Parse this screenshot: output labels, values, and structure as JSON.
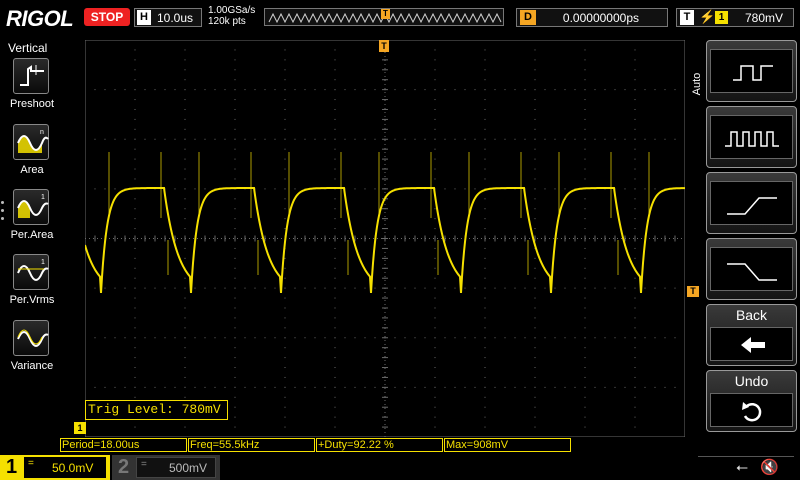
{
  "brand": "RIGOL",
  "status": "STOP",
  "horizontal": {
    "key": "H",
    "timebase": "10.0us"
  },
  "acquisition": {
    "sample_rate": "1.00GSa/s",
    "memory_depth": "120k pts"
  },
  "delay": {
    "key": "D",
    "value": "0.00000000ps"
  },
  "trigger": {
    "key": "T",
    "source": "1",
    "level": "780mV",
    "marker": "T"
  },
  "left_menu": {
    "title": "Vertical",
    "items": [
      {
        "label": "Preshoot",
        "icon": "preshoot-icon"
      },
      {
        "label": "Area",
        "icon": "area-icon"
      },
      {
        "label": "Per.Area",
        "icon": "period-area-icon"
      },
      {
        "label": "Per.Vrms",
        "icon": "period-vrms-icon"
      },
      {
        "label": "Variance",
        "icon": "variance-icon"
      }
    ]
  },
  "trig_level_popup": "Trig Level: 780mV",
  "measurements": [
    {
      "label": "Period=18.00us"
    },
    {
      "label": "Freq=55.5kHz"
    },
    {
      "label": "+Duty=92.22 %"
    },
    {
      "label": "Max=908mV"
    }
  ],
  "right_menu": {
    "tab_label": "Auto",
    "buttons": [
      {
        "icon": "single-pulse-icon"
      },
      {
        "icon": "pulse-train-icon"
      },
      {
        "icon": "rising-edge-icon"
      },
      {
        "icon": "falling-edge-icon"
      },
      {
        "label": "Back",
        "icon": "back-arrow-icon"
      },
      {
        "label": "Undo",
        "icon": "undo-icon"
      }
    ]
  },
  "channels": [
    {
      "number": "1",
      "coupling": "=",
      "scale": "50.0mV",
      "active": true,
      "color": "#f5e000"
    },
    {
      "number": "2",
      "coupling": "=",
      "scale": "500mV",
      "active": false,
      "color": "#888888"
    }
  ],
  "ch1_marker": "1",
  "colors": {
    "trace": "#f5e000",
    "trigger": "#f5a623",
    "grid": "#6a6a6a",
    "stop": "#e22222"
  }
}
